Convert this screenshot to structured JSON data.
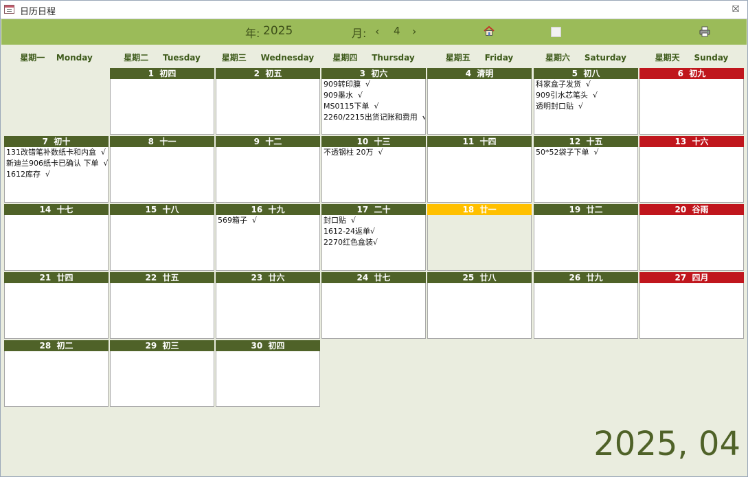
{
  "window": {
    "title": "日历日程",
    "close_glyph": "⛝"
  },
  "header": {
    "year_label": "年:",
    "year": "2025",
    "month_label": "月:",
    "prev": "‹",
    "month": "4",
    "next": "›"
  },
  "weekdays": [
    "星期一    Monday",
    "星期二     Tuesday",
    "星期三     Wednesday",
    "星期四     Thursday",
    "星期五     Friday",
    "星期六     Saturday",
    "星期天     Sunday"
  ],
  "days": [
    {
      "label": "1  初四",
      "events": []
    },
    {
      "label": "2  初五",
      "events": []
    },
    {
      "label": "3  初六",
      "events": [
        "909转印膜  √",
        "909墨水  √",
        "MS0115下单  √",
        "2260/2215出货记账和费用  √"
      ]
    },
    {
      "label": "4  清明",
      "events": []
    },
    {
      "label": "5  初八",
      "events": [
        "科家盒子发货  √",
        "909引水芯笔头  √",
        "透明封口贴  √"
      ]
    },
    {
      "label": "6  初九",
      "events": []
    },
    {
      "label": "7  初十",
      "events": [
        "131改错笔补数纸卡和内盒  √",
        "新迪兰906纸卡已确认 下单  √",
        "1612库存  √"
      ]
    },
    {
      "label": "8  十一",
      "events": []
    },
    {
      "label": "9  十二",
      "events": []
    },
    {
      "label": "10  十三",
      "events": [
        "不透钢柱 20万  √"
      ]
    },
    {
      "label": "11  十四",
      "events": []
    },
    {
      "label": "12  十五",
      "events": [
        "50*52袋子下单  √"
      ]
    },
    {
      "label": "13  十六",
      "events": []
    },
    {
      "label": "14  十七",
      "events": []
    },
    {
      "label": "15  十八",
      "events": []
    },
    {
      "label": "16  十九",
      "events": [
        "569箱子  √"
      ]
    },
    {
      "label": "17  二十",
      "events": [
        "封口贴  √",
        "1612-24返单√",
        "2270红色盒装√"
      ]
    },
    {
      "label": "18  廿一",
      "events": []
    },
    {
      "label": "19  廿二",
      "events": []
    },
    {
      "label": "20  谷雨",
      "events": []
    },
    {
      "label": "21  廿四",
      "events": []
    },
    {
      "label": "22  廿五",
      "events": []
    },
    {
      "label": "23  廿六",
      "events": []
    },
    {
      "label": "24  廿七",
      "events": []
    },
    {
      "label": "25  廿八",
      "events": []
    },
    {
      "label": "26  廿九",
      "events": []
    },
    {
      "label": "27  四月",
      "events": []
    },
    {
      "label": "28  初二",
      "events": []
    },
    {
      "label": "29  初三",
      "events": []
    },
    {
      "label": "30  初四",
      "events": []
    }
  ],
  "first_weekday_index": 1,
  "today": 18,
  "sunday_color": "#c0161d",
  "today_color": "#ffc000",
  "day_header_color": "#4f6228",
  "big_date": "2025, 04",
  "icons": {
    "home": "home-icon",
    "printer": "printer-icon",
    "blank": "blank-square",
    "app": "calendar-form-icon"
  }
}
